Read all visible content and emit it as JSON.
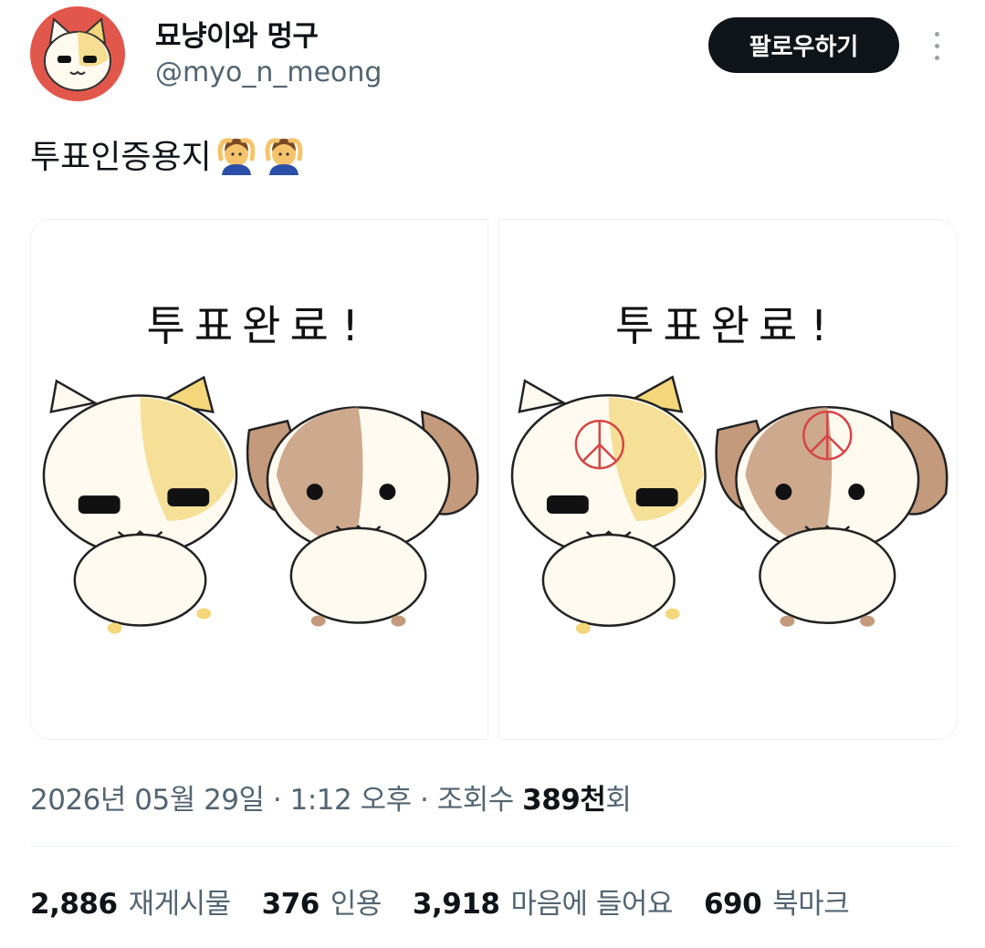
{
  "author": {
    "display_name": "묘냥이와 멍구",
    "handle": "@myo_n_meong"
  },
  "header": {
    "follow_label": "팔로우하기",
    "more_icon": "more-vertical-icon"
  },
  "tweet": {
    "text": "투표인증용지",
    "emojis": [
      "person-gesturing-ok-emoji",
      "person-gesturing-ok-emoji"
    ]
  },
  "media": [
    {
      "caption": "투표완료!",
      "stamp": false
    },
    {
      "caption": "투표완료!",
      "stamp": true
    }
  ],
  "meta": {
    "date": "2026년 05월 29일",
    "sep1": " · ",
    "time": "1:12 오후",
    "sep2": " · ",
    "views_label": "조회수 ",
    "views_value": "389천",
    "views_suffix": "회"
  },
  "stats": {
    "retweets": {
      "value": "2,886",
      "label": "재게시물"
    },
    "quotes": {
      "value": "376",
      "label": "인용"
    },
    "likes": {
      "value": "3,918",
      "label": "마음에 들어요"
    },
    "bookmarks": {
      "value": "690",
      "label": "북마크"
    }
  },
  "colors": {
    "avatar_bg": "#e2574c",
    "button_bg": "#0f1419",
    "muted_text": "#536471",
    "stamp_red": "#d64545"
  }
}
